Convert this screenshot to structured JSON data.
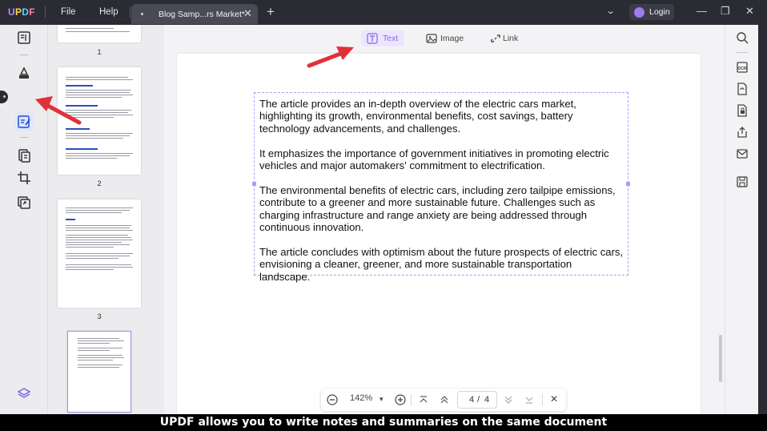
{
  "app": {
    "logo": {
      "u": "U",
      "p": "P",
      "d": "D",
      "f": "F"
    },
    "menu": {
      "file": "File",
      "help": "Help"
    },
    "tab": {
      "title": "Blog Samp...rs Market*",
      "close": "✕",
      "add": "+"
    },
    "login": "Login",
    "window": {
      "minimize": "—",
      "restore": "❐",
      "close": "✕"
    }
  },
  "edit_toolbar": {
    "text": "Text",
    "image": "Image",
    "link": "Link"
  },
  "thumbnails": [
    {
      "label": "1"
    },
    {
      "label": "2"
    },
    {
      "label": "3"
    },
    {
      "label": ""
    }
  ],
  "document": {
    "paragraphs": [
      "The article provides an in-depth overview of the electric cars market, highlighting its growth, environmental benefits, cost savings, battery technology advancements, and challenges.",
      "It emphasizes the importance of government initiatives in promoting electric vehicles and major automakers' commitment to electrification.",
      "The environmental benefits of electric cars, including zero tailpipe emissions, contribute to a greener and more sustainable future. Challenges such as charging infrastructure and range anxiety are being addressed through continuous innovation.",
      "The article concludes with optimism about the future prospects of electric cars, envisioning a cleaner, greener, and more sustainable transportation landscape."
    ]
  },
  "navigation": {
    "zoom": "142%",
    "current_page": "4",
    "separator": "/",
    "total_pages": "4",
    "zoom_out": "−",
    "zoom_in": "+",
    "dropdown": "▾",
    "close": "✕"
  },
  "caption": "UPDF allows you to write notes and summaries on the same document",
  "colors": {
    "accent": "#8a63e8",
    "titlebar": "#2b2b33",
    "annotation_arrow": "#e0313a"
  }
}
